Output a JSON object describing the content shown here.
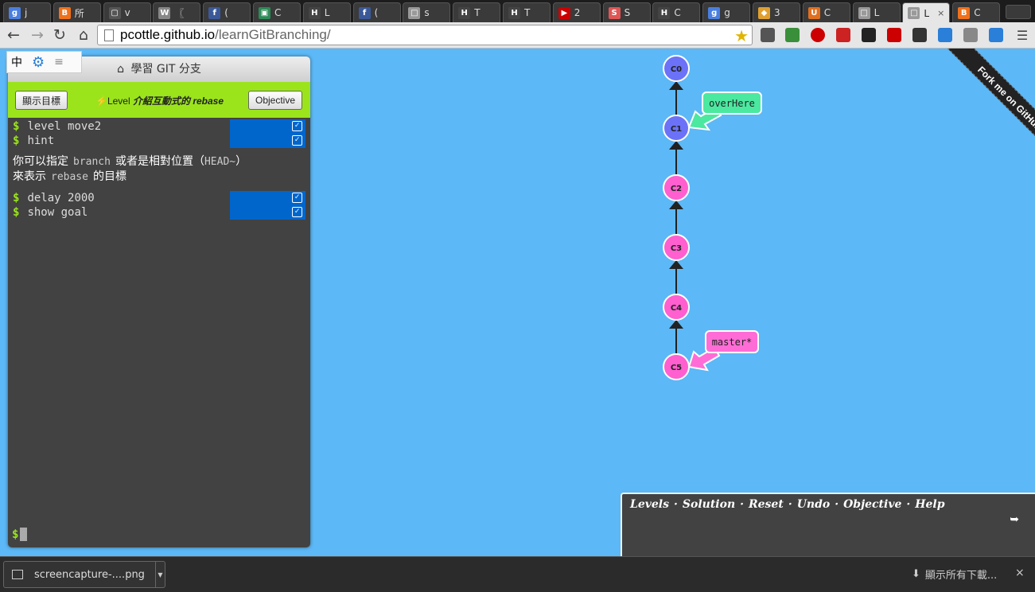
{
  "browser": {
    "tabs": [
      {
        "icon": "g",
        "title": "j",
        "color": "#4a7fe0"
      },
      {
        "icon": "B",
        "title": "所",
        "color": "#f0711c"
      },
      {
        "icon": "▢",
        "title": "v",
        "color": "#555"
      },
      {
        "icon": "W",
        "title": "〖",
        "color": "#888"
      },
      {
        "icon": "f",
        "title": "(",
        "color": "#3b5998"
      },
      {
        "icon": "▣",
        "title": "C",
        "color": "#2e8b57"
      },
      {
        "icon": "H",
        "title": "L",
        "color": "#444"
      },
      {
        "icon": "f",
        "title": "(",
        "color": "#3b5998"
      },
      {
        "icon": "□",
        "title": "s",
        "color": "#999"
      },
      {
        "icon": "H",
        "title": "T",
        "color": "#444"
      },
      {
        "icon": "H",
        "title": "T",
        "color": "#444"
      },
      {
        "icon": "▶",
        "title": "2",
        "color": "#cc0000"
      },
      {
        "icon": "S",
        "title": "S",
        "color": "#e05555"
      },
      {
        "icon": "H",
        "title": "C",
        "color": "#444"
      },
      {
        "icon": "g",
        "title": "g",
        "color": "#4a7fe0"
      },
      {
        "icon": "◆",
        "title": "3",
        "color": "#e0a030"
      },
      {
        "icon": "U",
        "title": "C",
        "color": "#e07020"
      },
      {
        "icon": "□",
        "title": "L",
        "color": "#999"
      },
      {
        "icon": "□",
        "title": "L",
        "color": "#999"
      },
      {
        "icon": "B",
        "title": "C",
        "color": "#f0711c"
      }
    ],
    "active_tab_index": 18,
    "active_tab_close": "×",
    "url_host": "pcottle.github.io",
    "url_path": "/learnGitBranching/",
    "star": "★"
  },
  "ime": {
    "lang": "中",
    "gear": "⚙",
    "menu": "≡"
  },
  "terminal": {
    "title": "學習 GIT 分支",
    "show_goal_button": "顯示目標",
    "level_prefix": "Level",
    "level_name": "介紹互動式的 rebase",
    "objective_button": "Objective",
    "commands_top": [
      {
        "text": "level move2"
      },
      {
        "text": "hint"
      }
    ],
    "hint_part1": "你可以指定",
    "hint_code1": "branch",
    "hint_part2": "或者是相對位置（",
    "hint_code2": "HEAD~",
    "hint_part3": "）",
    "hint_part4": "來表示",
    "hint_code3": "rebase",
    "hint_part5": "的目標",
    "commands_bottom": [
      {
        "text": "delay 2000"
      },
      {
        "text": "show goal"
      }
    ],
    "prompt": "$"
  },
  "git": {
    "commits": [
      "C0",
      "C1",
      "C2",
      "C3",
      "C4",
      "C5"
    ],
    "branch_overhere": "overHere",
    "branch_master": "master*",
    "colors": {
      "blue_commit": "#6b72f8",
      "pink_commit": "#ff5fcf",
      "overhere": "#4be8a0",
      "master": "#ff6cd6"
    }
  },
  "ribbon": "Fork me on GitHub",
  "commandbar": {
    "links": [
      "Levels",
      "Solution",
      "Reset",
      "Undo",
      "Objective",
      "Help"
    ],
    "separator": "·"
  },
  "downloads": {
    "file": "screencapture-....png",
    "show_all": "顯示所有下載...",
    "close": "×"
  }
}
